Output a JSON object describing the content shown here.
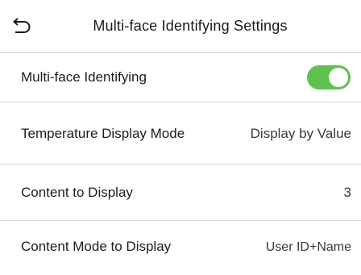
{
  "header": {
    "title": "Multi-face Identifying Settings",
    "back_icon": "back-arrow-icon"
  },
  "settings": [
    {
      "label": "Multi-face Identifying",
      "type": "toggle",
      "enabled": true,
      "accent": "#5fc14e"
    },
    {
      "label": "Temperature Display Mode",
      "type": "value",
      "value": "Display by Value"
    },
    {
      "label": "Content to Display",
      "type": "value",
      "value": "3"
    },
    {
      "label": "Content Mode to Display",
      "type": "value",
      "value": "User ID+Name"
    }
  ]
}
